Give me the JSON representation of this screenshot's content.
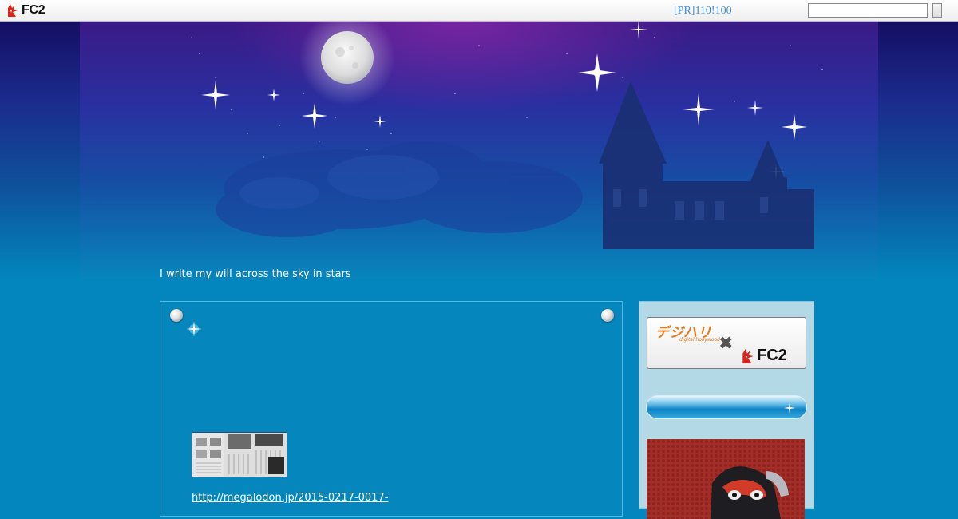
{
  "topbar": {
    "brand": "FC2",
    "pr_link": "[PR]110!100",
    "search": {
      "value": "",
      "placeholder": ""
    },
    "search_button_label": ""
  },
  "header": {
    "tagline": "I write my will across the sky in stars"
  },
  "entry": {
    "link_text": "http://megalodon.jp/2015-0217-0017-"
  },
  "sidebar": {
    "banner": {
      "brand_left": "デジハリ",
      "brand_left_sub": "digital hollywood",
      "separator": "✖",
      "brand_right": "FC2"
    },
    "heading": ""
  },
  "colors": {
    "background": "#0286bd",
    "sidebar_bg": "#b4d9e6",
    "link": "#3c8fd4",
    "banner_accent": "#e8781e"
  },
  "icons": [
    "fc2-logo-icon",
    "pushpin-icon",
    "sparkle-icon",
    "search-button"
  ]
}
